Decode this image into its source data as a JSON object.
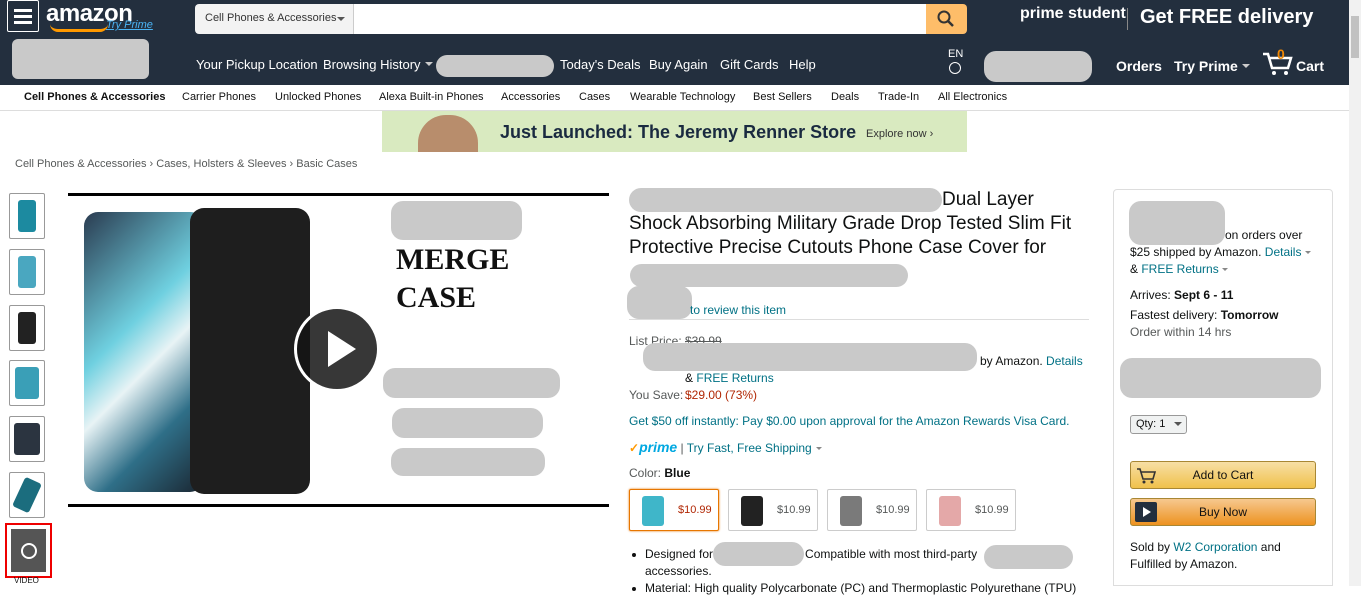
{
  "header": {
    "logo_text": "amazon",
    "try_prime": "Try Prime",
    "search_category": "Cell Phones & Accessories",
    "search_placeholder": "",
    "prime_student": "prime student",
    "get_free_delivery": "Get FREE delivery",
    "nav": [
      "Your Pickup Location",
      "Browsing History",
      "Today's Deals",
      "Buy Again",
      "Gift Cards",
      "Help"
    ],
    "lang": "EN",
    "orders": "Orders",
    "try_prime_menu": "Try Prime",
    "cart_count": "0",
    "cart_label": "Cart"
  },
  "categories": [
    "Cell Phones & Accessories",
    "Carrier Phones",
    "Unlocked Phones",
    "Alexa Built-in Phones",
    "Accessories",
    "Cases",
    "Wearable Technology",
    "Best Sellers",
    "Deals",
    "Trade-In",
    "All Electronics"
  ],
  "banner": {
    "text": "Just Launched: The Jeremy Renner Store",
    "cta": "Explore now ›"
  },
  "breadcrumb": [
    "Cell Phones & Accessories",
    "›",
    "Cases, Holsters & Sleeves",
    "›",
    "Basic Cases"
  ],
  "image": {
    "merge_line1": "MERGE",
    "merge_line2": "CASE",
    "video_label": "VIDEO"
  },
  "product": {
    "title_tail": "Dual Layer Shock Absorbing Military Grade Drop Tested Slim Fit Protective Precise Cutouts Phone Case Cover for",
    "review_link": "to review this item",
    "list_price_label": "List Price:",
    "list_price": "$39.99",
    "by_amazon": "by Amazon.",
    "details": "Details",
    "free_returns_amp": "&",
    "free_returns": "FREE Returns",
    "you_save_label": "You Save:",
    "you_save": "$29.00 (73%)",
    "promo": "Get $50 off instantly: Pay $0.00 upon approval for the Amazon Rewards Visa Card.",
    "prime_word": "prime",
    "prime_sep": "|",
    "prime_shipping": "Try Fast, Free Shipping",
    "color_label": "Color:",
    "color_value": "Blue",
    "swatches": [
      {
        "price": "$10.99",
        "color": "#3fb6c9"
      },
      {
        "price": "$10.99",
        "color": "#222222"
      },
      {
        "price": "$10.99",
        "color": "#7a7a7a"
      },
      {
        "price": "$10.99",
        "color": "#e4a8a8"
      }
    ],
    "bullet1_a": "Designed for",
    "bullet1_b": "Compatible with most third-party",
    "bullet1_c": "accessories.",
    "bullet2": "Material: High quality Polycarbonate (PC) and Thermoplastic Polyurethane (TPU)"
  },
  "buybox": {
    "orders_over": "on orders over",
    "shipped": "$25 shipped by Amazon.",
    "details": "Details",
    "free_returns": "FREE Returns",
    "arrives_label": "Arrives:",
    "arrives": "Sept 6 - 11",
    "fastest_label": "Fastest delivery:",
    "fastest": "Tomorrow",
    "order_within": "Order within 14 hrs",
    "qty": "Qty: 1",
    "add_to_cart": "Add to Cart",
    "buy_now": "Buy Now",
    "sold_by": "Sold by",
    "seller": "W2 Corporation",
    "and": "and",
    "fulfilled": "Fulfilled by Amazon."
  }
}
